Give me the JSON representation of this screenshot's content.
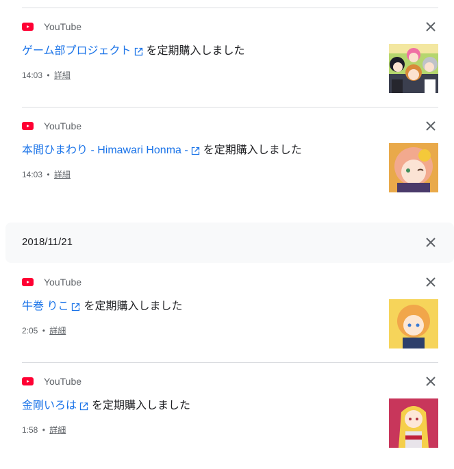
{
  "entries": [
    {
      "source": "YouTube",
      "link_text": "ゲーム部プロジェクト",
      "suffix": "を定期購入しました",
      "time": "14:03",
      "details_label": "詳細"
    },
    {
      "source": "YouTube",
      "link_text": "本間ひまわり - Himawari Honma -",
      "suffix": "を定期購入しました",
      "time": "14:03",
      "details_label": "詳細"
    },
    {
      "source": "YouTube",
      "link_text": "牛巻 りこ",
      "suffix": "を定期購入しました",
      "time": "2:05",
      "details_label": "詳細"
    },
    {
      "source": "YouTube",
      "link_text": "金剛いろは",
      "suffix": "を定期購入しました",
      "time": "1:58",
      "details_label": "詳細"
    }
  ],
  "date_header": {
    "date": "2018/11/21"
  },
  "meta_separator": "•",
  "colors": {
    "youtube": "#ff0033",
    "link": "#1a73e8",
    "divider": "#dadce0",
    "date_bg": "#f8f9fa"
  },
  "icons": {
    "source": "youtube-icon",
    "close": "close-icon",
    "external": "external-link-icon"
  }
}
